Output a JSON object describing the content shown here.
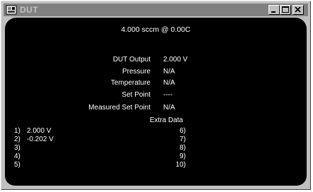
{
  "window": {
    "title": "DUT",
    "controls": {
      "minimize": "minimize",
      "maximize": "maximize",
      "close": "close"
    }
  },
  "header": {
    "flow_text": "4.000 sccm @ 0.00C"
  },
  "readings": [
    {
      "label": "DUT Output",
      "value": "2.000 V"
    },
    {
      "label": "Pressure",
      "value": "N/A"
    },
    {
      "label": "Temperature",
      "value": "N/A"
    },
    {
      "label": "Set Point",
      "value": "----"
    },
    {
      "label": "Measured Set Point",
      "value": "N/A"
    }
  ],
  "extra_data": {
    "title": "Extra Data",
    "left": [
      {
        "index": "1)",
        "value": "2.000 V"
      },
      {
        "index": "2)",
        "value": "-0.202 V"
      },
      {
        "index": "3)",
        "value": ""
      },
      {
        "index": "4)",
        "value": ""
      },
      {
        "index": "5)",
        "value": ""
      }
    ],
    "right": [
      {
        "index": "6)",
        "value": ""
      },
      {
        "index": "7)",
        "value": ""
      },
      {
        "index": "8)",
        "value": ""
      },
      {
        "index": "9)",
        "value": ""
      },
      {
        "index": "10)",
        "value": ""
      }
    ]
  },
  "colors": {
    "titlebar": "#808080",
    "panel": "#000000",
    "text": "#ffffff",
    "chrome": "#c0c0c0"
  },
  "icons": {
    "app": "app-icon",
    "minimize": "minimize-icon",
    "maximize": "maximize-icon",
    "close": "close-icon"
  }
}
